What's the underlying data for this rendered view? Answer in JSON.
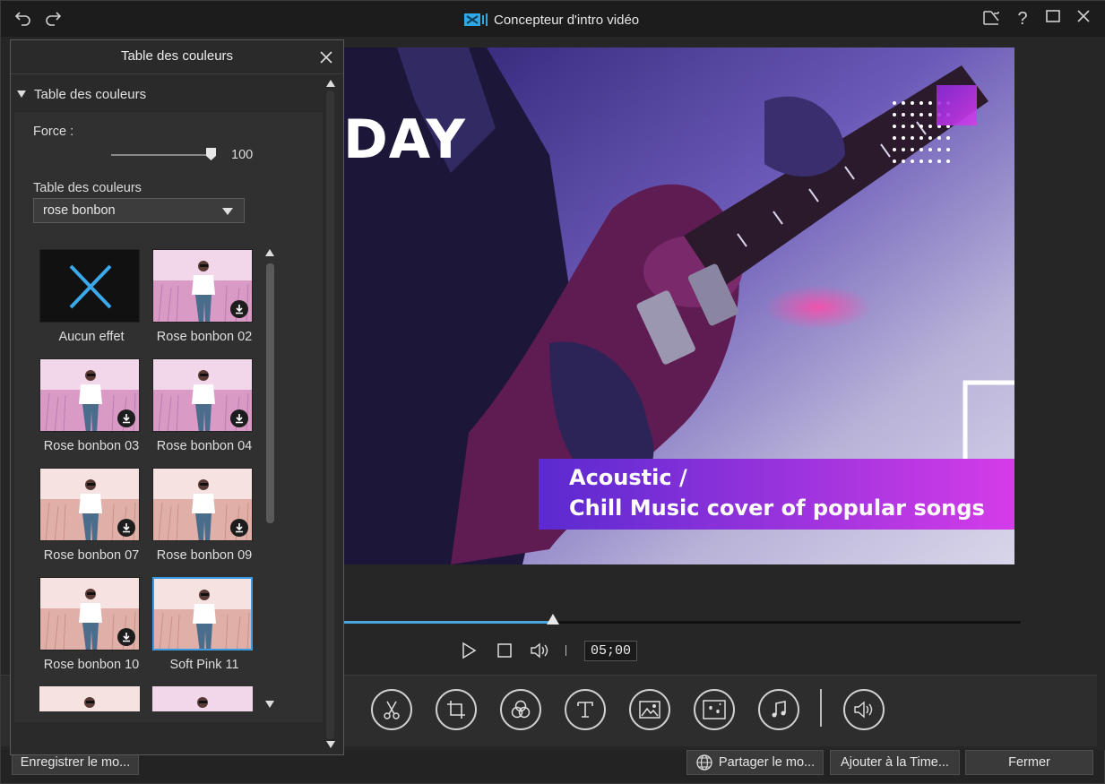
{
  "window": {
    "title": "Concepteur d'intro vidéo"
  },
  "preview": {
    "headline": "DAY",
    "banner_line1": "Acoustic /",
    "banner_line2": "Chill Music cover of popular songs"
  },
  "playback": {
    "timecode": "05;00",
    "progress": 0.31
  },
  "panel": {
    "title": "Table des couleurs",
    "section_title": "Table des couleurs",
    "force_label": "Force :",
    "force_value": "100",
    "table_label": "Table des couleurs",
    "table_selected": "rose bonbon",
    "items": [
      {
        "label": "Aucun effet",
        "type": "none"
      },
      {
        "label": "Rose bonbon 02",
        "type": "rose",
        "download": true
      },
      {
        "label": "Rose bonbon 03",
        "type": "rose",
        "download": true
      },
      {
        "label": "Rose bonbon 04",
        "type": "rose",
        "download": true
      },
      {
        "label": "Rose bonbon 07",
        "type": "peach",
        "download": true
      },
      {
        "label": "Rose bonbon 09",
        "type": "peach",
        "download": true
      },
      {
        "label": "Rose bonbon 10",
        "type": "peach",
        "download": true
      },
      {
        "label": "Soft Pink 11",
        "type": "peach",
        "download": false,
        "selected": true
      }
    ]
  },
  "footer": {
    "save_label": "Enregistrer le mo...",
    "share_label": "Partager le mo...",
    "add_label": "Ajouter à la Time...",
    "close_label": "Fermer"
  },
  "colors": {
    "accent": "#3a9be4",
    "banner_start": "#5a2ad0",
    "banner_end": "#d43ce8"
  }
}
